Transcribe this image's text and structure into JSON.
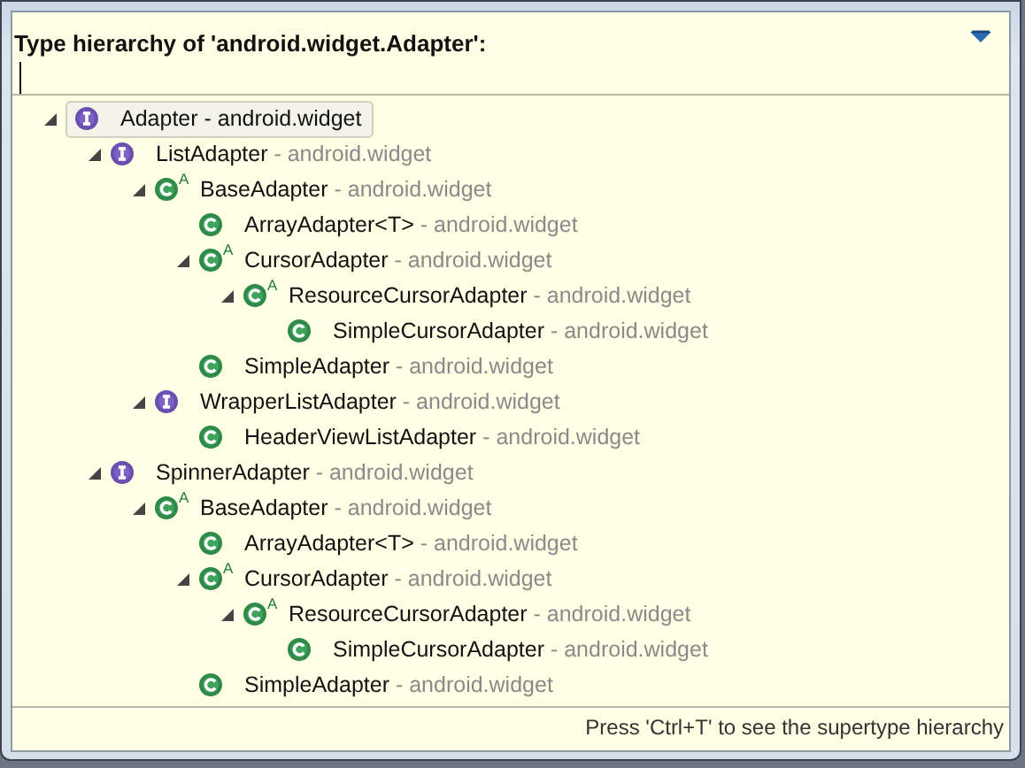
{
  "title": "Type hierarchy of 'android.widget.Adapter':",
  "tree": [
    {
      "kind": "interface",
      "name": "Adapter",
      "package": " - android.widget",
      "selected": true,
      "expanded": true,
      "children": [
        {
          "kind": "interface",
          "name": "ListAdapter",
          "package": " - android.widget",
          "selected": false,
          "expanded": true,
          "children": [
            {
              "kind": "class",
              "abstract_mark": "A",
              "name": "BaseAdapter",
              "package": " - android.widget",
              "selected": false,
              "expanded": true,
              "children": [
                {
                  "kind": "class",
                  "name": "ArrayAdapter<T>",
                  "package": " - android.widget",
                  "selected": false
                },
                {
                  "kind": "class",
                  "abstract_mark": "A",
                  "name": "CursorAdapter",
                  "package": " - android.widget",
                  "selected": false,
                  "expanded": true,
                  "children": [
                    {
                      "kind": "class",
                      "abstract_mark": "A",
                      "name": "ResourceCursorAdapter",
                      "package": " - android.widget",
                      "selected": false,
                      "expanded": true,
                      "children": [
                        {
                          "kind": "class",
                          "name": "SimpleCursorAdapter",
                          "package": " - android.widget",
                          "selected": false
                        }
                      ]
                    }
                  ]
                },
                {
                  "kind": "class",
                  "name": "SimpleAdapter",
                  "package": " - android.widget",
                  "selected": false
                }
              ]
            },
            {
              "kind": "interface",
              "name": "WrapperListAdapter",
              "package": " - android.widget",
              "selected": false,
              "expanded": true,
              "children": [
                {
                  "kind": "class",
                  "name": "HeaderViewListAdapter",
                  "package": " - android.widget",
                  "selected": false
                }
              ]
            }
          ]
        },
        {
          "kind": "interface",
          "name": "SpinnerAdapter",
          "package": " - android.widget",
          "selected": false,
          "expanded": true,
          "children": [
            {
              "kind": "class",
              "abstract_mark": "A",
              "name": "BaseAdapter",
              "package": " - android.widget",
              "selected": false,
              "expanded": true,
              "children": [
                {
                  "kind": "class",
                  "name": "ArrayAdapter<T>",
                  "package": " - android.widget",
                  "selected": false
                },
                {
                  "kind": "class",
                  "abstract_mark": "A",
                  "name": "CursorAdapter",
                  "package": " - android.widget",
                  "selected": false,
                  "expanded": true,
                  "children": [
                    {
                      "kind": "class",
                      "abstract_mark": "A",
                      "name": "ResourceCursorAdapter",
                      "package": " - android.widget",
                      "selected": false,
                      "expanded": true,
                      "children": [
                        {
                          "kind": "class",
                          "name": "SimpleCursorAdapter",
                          "package": " - android.widget",
                          "selected": false
                        }
                      ]
                    }
                  ]
                },
                {
                  "kind": "class",
                  "name": "SimpleAdapter",
                  "package": " - android.widget",
                  "selected": false
                }
              ]
            }
          ]
        }
      ]
    }
  ],
  "status": "Press 'Ctrl+T' to see the supertype hierarchy"
}
